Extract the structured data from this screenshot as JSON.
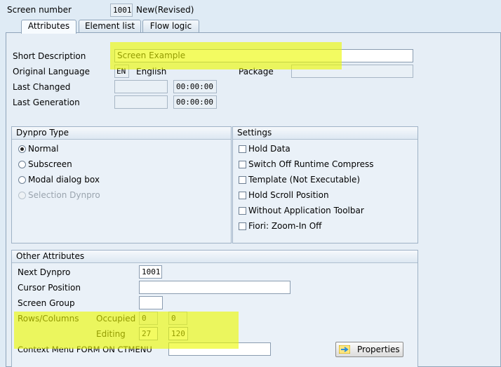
{
  "header": {
    "screen_number_label": "Screen number",
    "screen_number": "1001",
    "status": "New(Revised)"
  },
  "tabs": [
    {
      "label": "Attributes"
    },
    {
      "label": "Element list"
    },
    {
      "label": "Flow logic"
    }
  ],
  "attributes": {
    "short_description_label": "Short Description",
    "short_description": "Screen Example",
    "original_language_label": "Original Language",
    "language_code": "EN",
    "language_name": "English",
    "package_label": "Package",
    "package": "",
    "last_changed_label": "Last Changed",
    "last_changed_date": "",
    "last_changed_time": "00:00:00",
    "last_generation_label": "Last Generation",
    "last_generation_date": "",
    "last_generation_time": "00:00:00"
  },
  "dynpro_type": {
    "title": "Dynpro Type",
    "options": [
      {
        "label": "Normal",
        "checked": true,
        "disabled": false
      },
      {
        "label": "Subscreen",
        "checked": false,
        "disabled": false
      },
      {
        "label": "Modal dialog box",
        "checked": false,
        "disabled": false
      },
      {
        "label": "Selection Dynpro",
        "checked": false,
        "disabled": true
      }
    ]
  },
  "settings": {
    "title": "Settings",
    "options": [
      {
        "label": "Hold Data",
        "checked": false
      },
      {
        "label": "Switch Off Runtime Compress",
        "checked": false
      },
      {
        "label": "Template (Not Executable)",
        "checked": false
      },
      {
        "label": "Hold Scroll Position",
        "checked": false
      },
      {
        "label": "Without Application Toolbar",
        "checked": false
      },
      {
        "label": "Fiori: Zoom-In Off",
        "checked": false
      }
    ]
  },
  "other": {
    "title": "Other Attributes",
    "next_dynpro_label": "Next Dynpro",
    "next_dynpro": "1001",
    "cursor_position_label": "Cursor Position",
    "cursor_position": "",
    "screen_group_label": "Screen Group",
    "screen_group": "",
    "rows_columns_label": "Rows/Columns",
    "occupied_label": "Occupied",
    "occupied_rows": "0",
    "occupied_cols": "0",
    "editing_label": "Editing",
    "editing_rows": "27",
    "editing_cols": "120",
    "context_menu_label": "Context Menu FORM ON CTMENU",
    "context_menu": "",
    "properties_button": "Properties"
  },
  "colors": {
    "highlight": "#ecf800",
    "background": "#dfebf5",
    "properties_icon": "#2f8fd8"
  },
  "icons": {
    "properties_button_icon": "arrow-right-icon"
  }
}
